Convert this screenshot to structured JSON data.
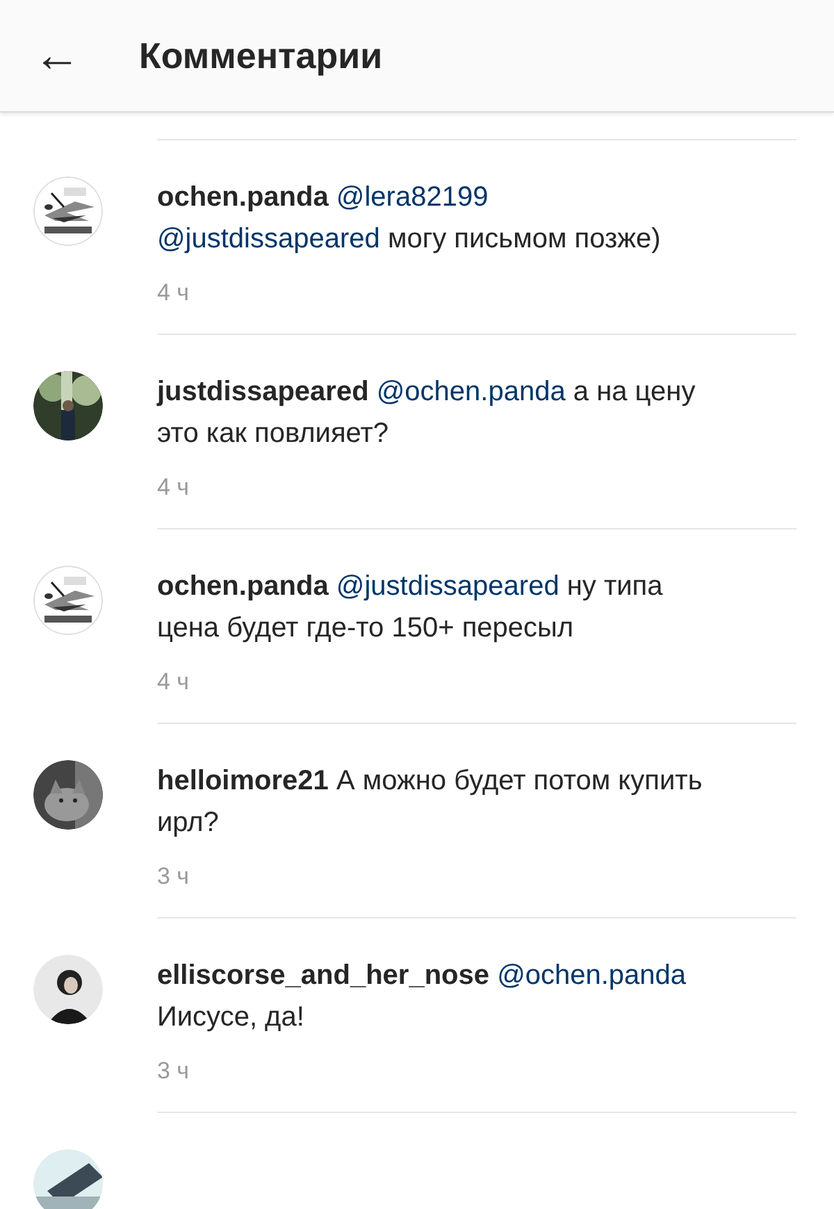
{
  "header": {
    "back_icon": "←",
    "title": "Комментарии"
  },
  "comments": [
    {
      "avatar": {
        "kind": "picture"
      },
      "author": "ochen.panda",
      "parts": [
        {
          "kind": "mention",
          "text": "@lera82199"
        },
        {
          "kind": "mention",
          "text": "@justdissapeared"
        },
        {
          "kind": "plain",
          "text": "могу письмом позже)"
        }
      ],
      "time": "4 ч"
    },
    {
      "avatar": {
        "kind": "picture"
      },
      "author": "justdissapeared",
      "parts": [
        {
          "kind": "mention",
          "text": "@ochen.panda"
        },
        {
          "kind": "plain",
          "text": "а на цену это как повлияет?"
        }
      ],
      "time": "4 ч"
    },
    {
      "avatar": {
        "kind": "picture"
      },
      "author": "ochen.panda",
      "parts": [
        {
          "kind": "mention",
          "text": "@justdissapeared"
        },
        {
          "kind": "plain",
          "text": "ну типа цена будет где-то 150+ пересыл"
        }
      ],
      "time": "4 ч"
    },
    {
      "avatar": {
        "kind": "picture"
      },
      "author": "helloimore21",
      "parts": [
        {
          "kind": "plain",
          "text": "А можно будет потом купить ирл?"
        }
      ],
      "time": "3 ч"
    },
    {
      "avatar": {
        "kind": "picture"
      },
      "author": "elliscorse_and_her_nose",
      "parts": [
        {
          "kind": "mention",
          "text": "@ochen.panda"
        },
        {
          "kind": "plain",
          "text": "Иисусе, да!"
        }
      ],
      "time": "3 ч"
    }
  ]
}
